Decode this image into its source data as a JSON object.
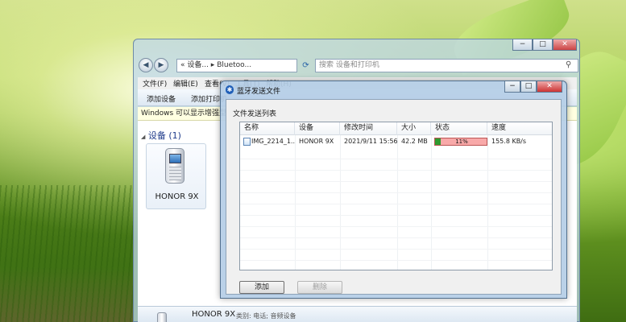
{
  "explorer": {
    "address": {
      "back_icon": "back-arrow-icon",
      "forward_icon": "forward-arrow-icon",
      "path": "« 设备... ▸ Bluetoo...",
      "search_placeholder": "搜索 设备和打印机",
      "refresh_icon": "refresh-icon"
    },
    "menu": {
      "file": "文件(F)",
      "edit": "编辑(E)",
      "view": "查看(V)",
      "tools": "工具(T)",
      "help": "帮助(H)"
    },
    "toolbar": {
      "add_device": "添加设备",
      "add_printer": "添加打印机"
    },
    "infobar": {
      "text": "Windows 可以显示增强型..."
    },
    "group": {
      "header": "设备 (1)",
      "collapse_glyph": "◢",
      "device_name": "HONOR 9X"
    },
    "details": {
      "name": "HONOR 9X",
      "category": "类别: 电话; 音频设备"
    }
  },
  "dialog": {
    "title": "蓝牙发送文件",
    "bt_glyph": "✱",
    "list_label": "文件发送列表",
    "columns": [
      "名称",
      "设备",
      "修改时间",
      "大小",
      "状态",
      "速度"
    ],
    "rows": [
      {
        "name": "IMG_2214_1...",
        "device": "HONOR 9X",
        "modified": "2021/9/11 15:56:...",
        "size": "42.2 MB",
        "progress_percent": 11,
        "progress_label": "11%",
        "speed": "155.8 KB/s"
      }
    ],
    "buttons": {
      "add": "添加",
      "delete": "删除"
    },
    "window_controls": {
      "minimize": "−",
      "maximize": "□",
      "close": "✕"
    }
  },
  "colors": {
    "progress_fill": "#2f9a2f",
    "progress_remaining": "#f8a9a9",
    "group_header": "#1e3a8a"
  }
}
